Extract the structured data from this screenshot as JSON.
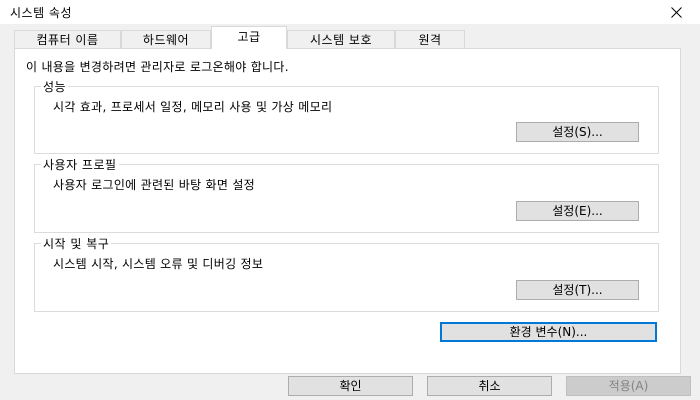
{
  "window": {
    "title": "시스템 속성"
  },
  "tabs": [
    {
      "label": "컴퓨터 이름"
    },
    {
      "label": "하드웨어"
    },
    {
      "label": "고급"
    },
    {
      "label": "시스템 보호"
    },
    {
      "label": "원격"
    }
  ],
  "active_tab": "고급",
  "admin_note": "이 내용을 변경하려면 관리자로 로그온해야 합니다.",
  "groups": {
    "performance": {
      "title": "성능",
      "description": "시각 효과, 프로세서 일정, 메모리 사용 및 가상 메모리",
      "button": "설정(S)..."
    },
    "user_profiles": {
      "title": "사용자 프로필",
      "description": "사용자 로그인에 관련된 바탕 화면 설정",
      "button": "설정(E)..."
    },
    "startup_recovery": {
      "title": "시작 및 복구",
      "description": "시스템 시작, 시스템 오류 및 디버깅 정보",
      "button": "설정(T)..."
    }
  },
  "env_button": "환경 변수(N)...",
  "footer": {
    "ok": "확인",
    "cancel": "취소",
    "apply": "적용(A)"
  },
  "icons": {
    "close": "close-icon"
  },
  "colors": {
    "focus_border": "#0078d7",
    "dialog_bg": "#f0f0f0"
  }
}
